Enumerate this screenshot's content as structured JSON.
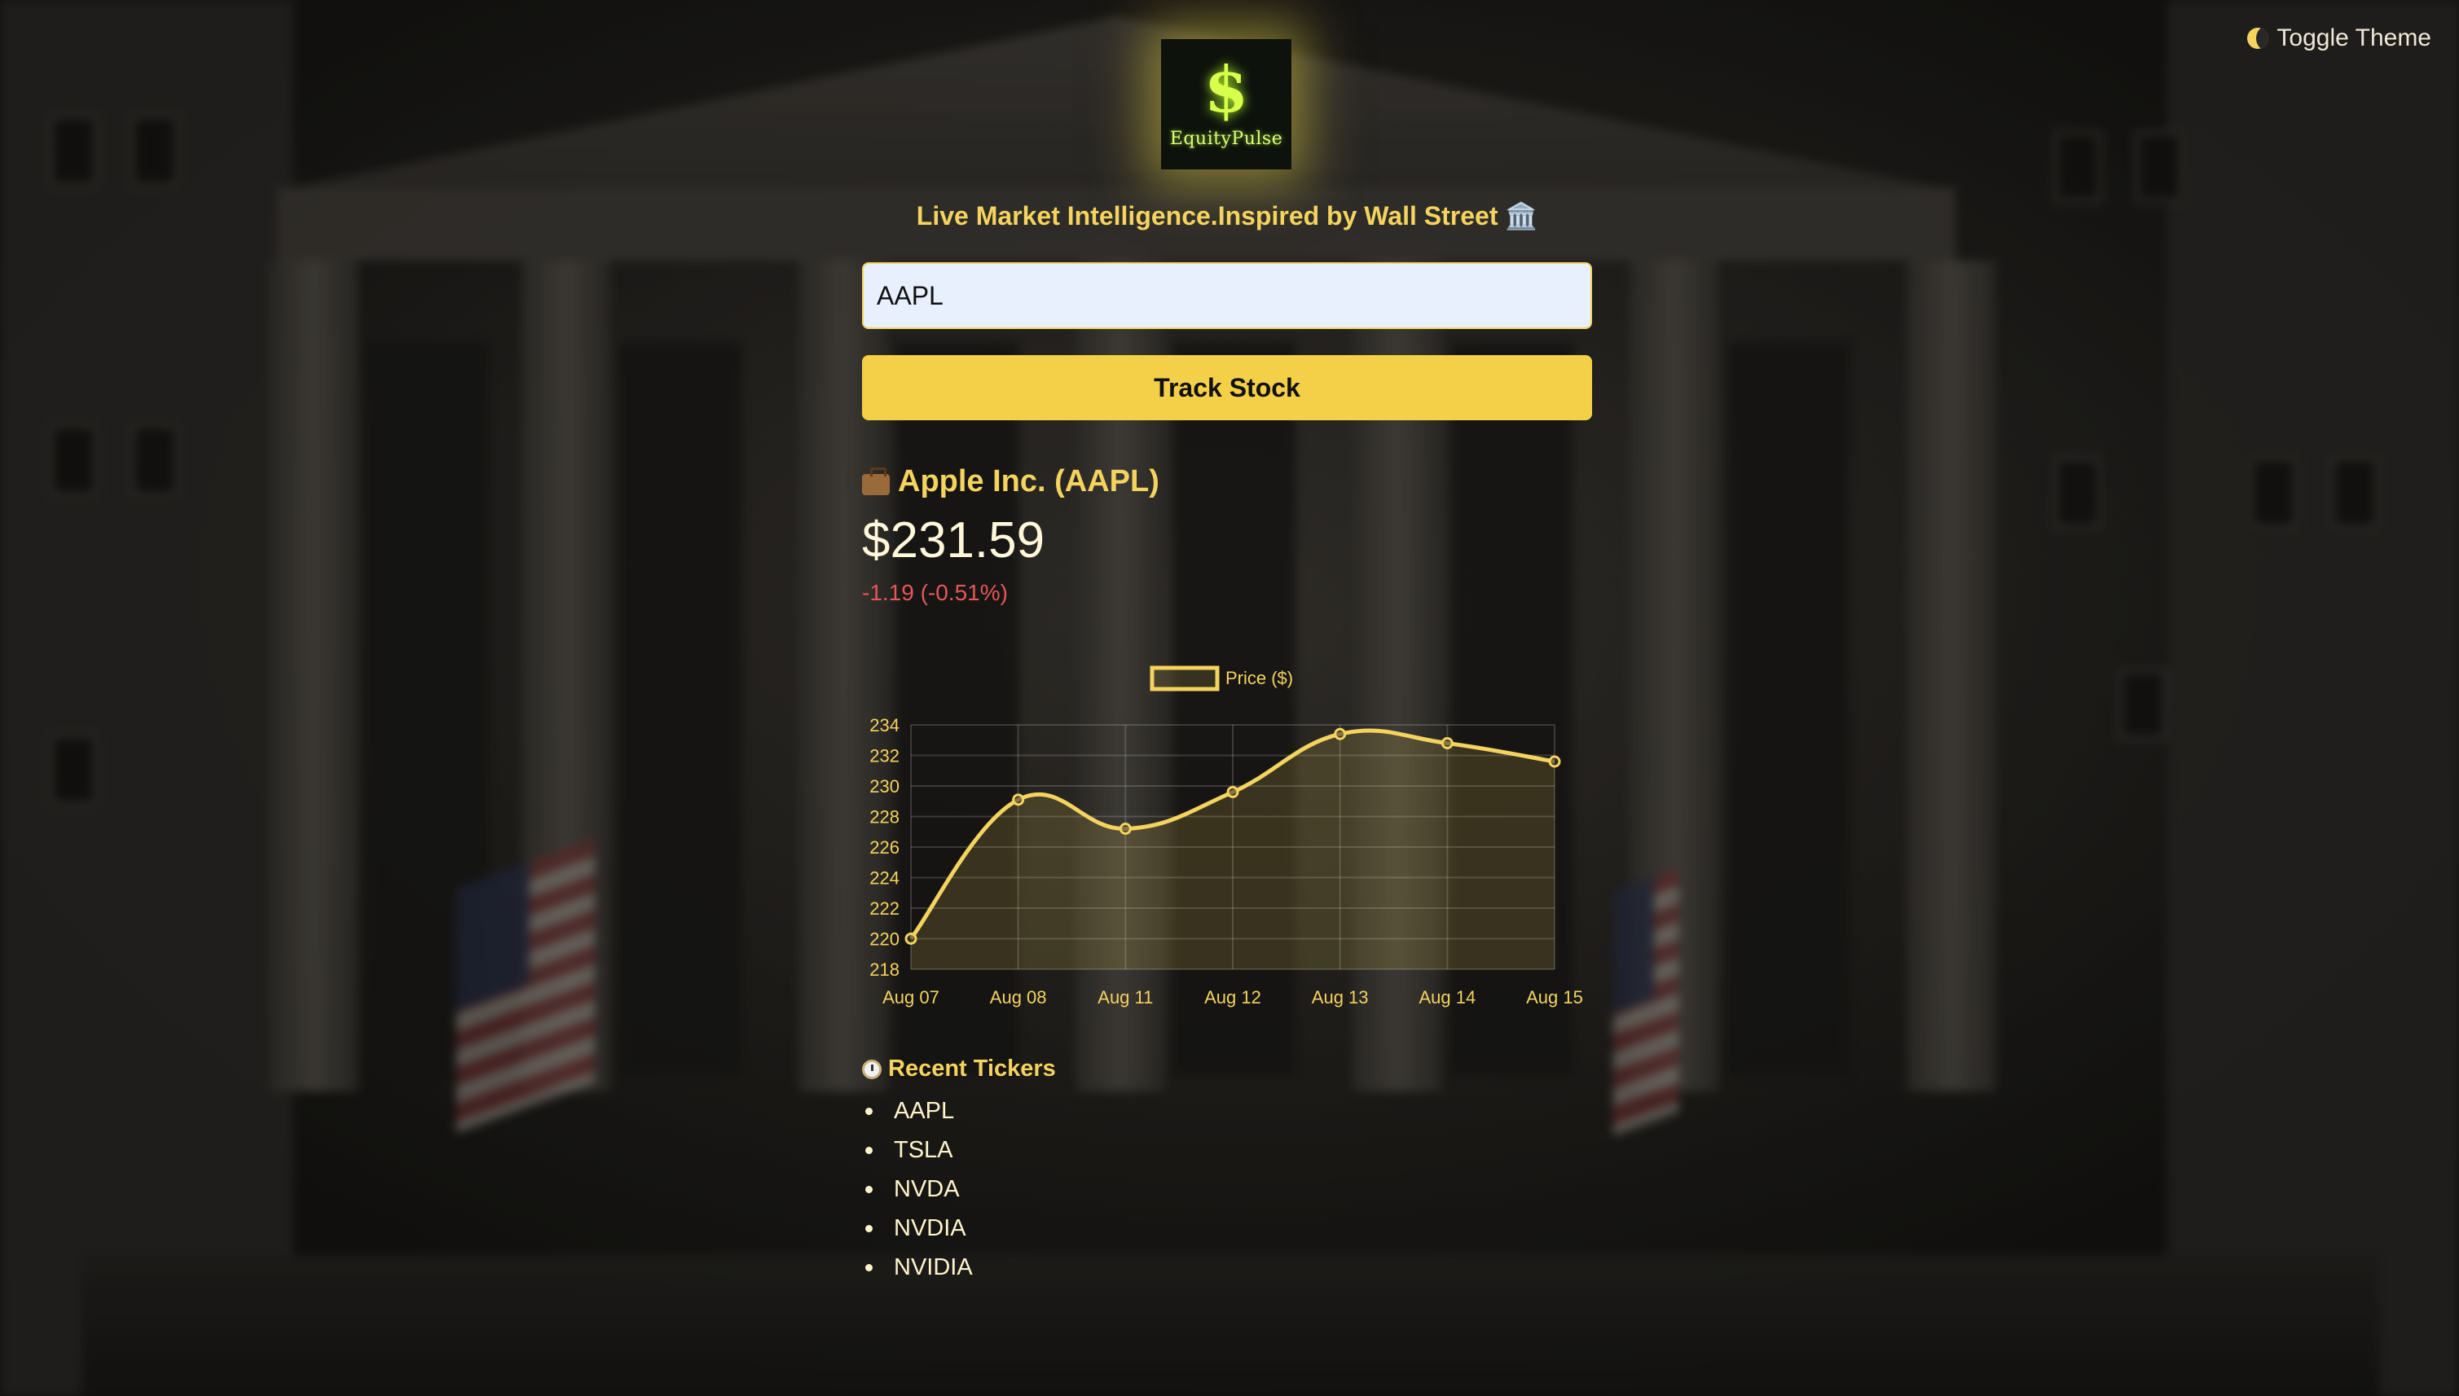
{
  "theme": {
    "accent": "#f4d35e",
    "button_bg": "#f4cf48",
    "negative": "#e45757",
    "input_bg": "#e8f0fe"
  },
  "header": {
    "toggle_label": "Toggle Theme",
    "toggle_icon": "moon-icon",
    "logo_symbol": "$",
    "logo_text": "EquityPulse",
    "tagline": "Live Market Intelligence.Inspired by Wall Street 🏛️"
  },
  "search": {
    "value": "AAPL",
    "button_label": "Track Stock"
  },
  "quote": {
    "company": "Apple Inc. (AAPL)",
    "company_icon": "briefcase-icon",
    "price": "$231.59",
    "change": "-1.19 (-0.51%)"
  },
  "chart_data": {
    "type": "line",
    "legend": "Price ($)",
    "categories": [
      "Aug 07",
      "Aug 08",
      "Aug 11",
      "Aug 12",
      "Aug 13",
      "Aug 14",
      "Aug 15"
    ],
    "series": [
      {
        "name": "Price ($)",
        "values": [
          220.0,
          229.1,
          227.2,
          229.6,
          233.4,
          232.8,
          231.6
        ]
      }
    ],
    "ylim": [
      218,
      234
    ],
    "yticks": [
      218,
      220,
      222,
      224,
      226,
      228,
      230,
      232,
      234
    ],
    "grid": true,
    "line_color": "#f4d35e",
    "fill": true
  },
  "recent": {
    "title": "Recent Tickers",
    "title_icon": "clock-icon",
    "items": [
      "AAPL",
      "TSLA",
      "NVDA",
      "NVDIA",
      "NVIDIA"
    ]
  }
}
